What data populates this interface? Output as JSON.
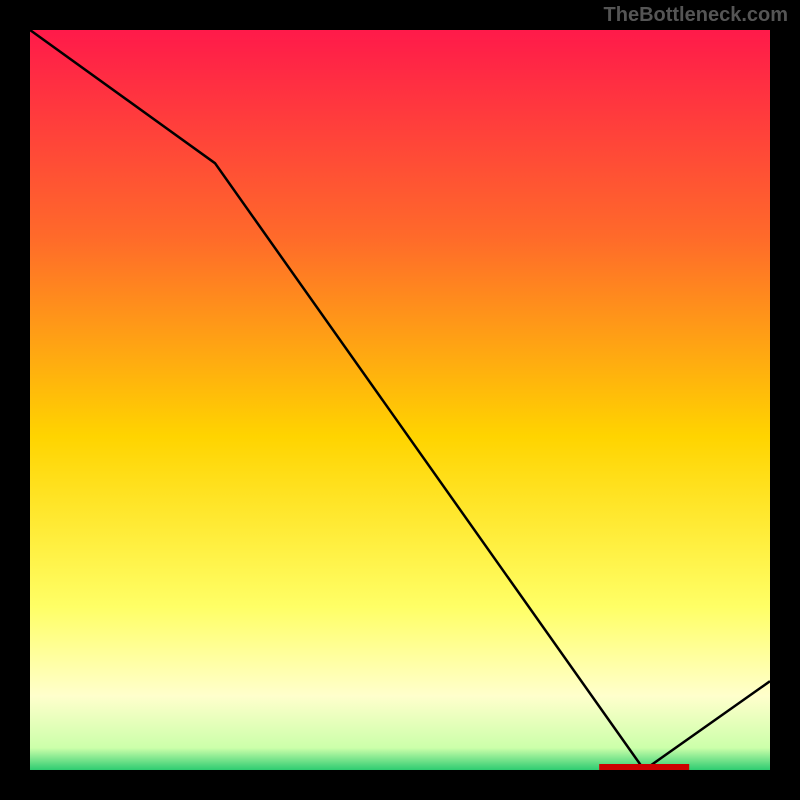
{
  "watermark": "TheBottleneck.com",
  "chart_data": {
    "type": "line",
    "title": "",
    "x": [
      0,
      0.25,
      0.83,
      1.0
    ],
    "values": [
      1.0,
      0.82,
      0.0,
      0.12
    ],
    "xlabel": "",
    "ylabel": "",
    "xlim": [
      0,
      1
    ],
    "ylim": [
      0,
      1
    ],
    "annotations": [
      {
        "text": "",
        "x": 0.83,
        "y": 0.0
      }
    ],
    "background": "vertical-gradient",
    "gradient_stops": [
      {
        "pos": 0.0,
        "color": "#ff1a4a"
      },
      {
        "pos": 0.28,
        "color": "#ff6a2a"
      },
      {
        "pos": 0.55,
        "color": "#ffd400"
      },
      {
        "pos": 0.78,
        "color": "#ffff66"
      },
      {
        "pos": 0.9,
        "color": "#ffffcc"
      },
      {
        "pos": 0.97,
        "color": "#ccffaa"
      },
      {
        "pos": 1.0,
        "color": "#2ecc71"
      }
    ]
  }
}
